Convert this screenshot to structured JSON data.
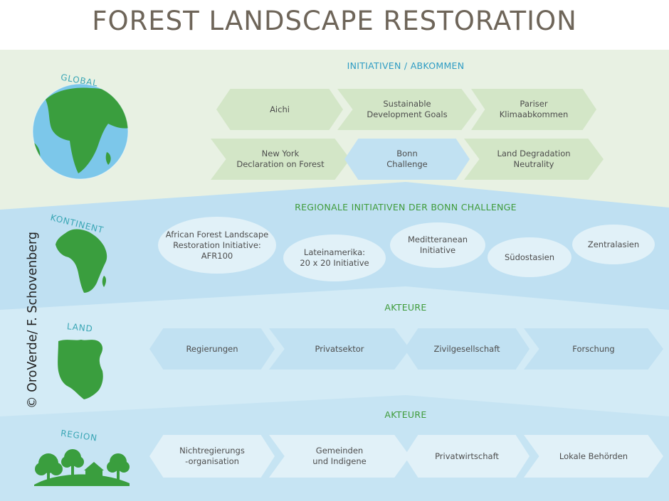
{
  "title": "FOREST LANDSCAPE RESTORATION",
  "credit": "© OroVerde/ F. Schovenberg",
  "colors": {
    "title": "#6e6559",
    "levelLabel": "#3aa6b5",
    "headingGreen": "#3f9b3a",
    "headingBlue": "#2e9cc4",
    "bandGlobal": "#e8f1e3",
    "bandKontinent": "#bfe0f2",
    "bandLand": "#d3ebf6",
    "bandRegion": "#c6e4f3",
    "shapeGreen": "#d3e6c7",
    "shapeBlue": "#c1e1f2",
    "shapeLight": "#e1f1f8",
    "map": "#3a9e3e",
    "ocean": "#7cc7ea"
  },
  "levels": {
    "global": "GLOBAL",
    "kontinent": "KONTINENT",
    "land": "LAND",
    "region": "REGION"
  },
  "global": {
    "heading": "INITIATIVEN / ABKOMMEN",
    "row1": [
      "Aichi",
      "Sustainable\nDevelopment Goals",
      "Pariser\nKlimaabkommen"
    ],
    "row2": [
      "New York\nDeclaration on Forest",
      "Bonn\nChallenge",
      "Land Degradation\nNeutrality"
    ]
  },
  "kontinent": {
    "heading": "REGIONALE INITIATIVEN DER BONN CHALLENGE",
    "items": [
      "African Forest Landscape\nRestoration Initiative:\nAFR100",
      "Lateinamerika:\n20 x 20 Initiative",
      "Meditteranean\nInitiative",
      "Südostasien",
      "Zentralasien"
    ]
  },
  "land": {
    "heading": "AKTEURE",
    "items": [
      "Regierungen",
      "Privatsektor",
      "Zivilgesellschaft",
      "Forschung"
    ]
  },
  "region": {
    "heading": "AKTEURE",
    "items": [
      "Nichtregierungs\n-organisation",
      "Gemeinden\nund Indigene",
      "Privatwirtschaft",
      "Lokale Behörden"
    ]
  }
}
